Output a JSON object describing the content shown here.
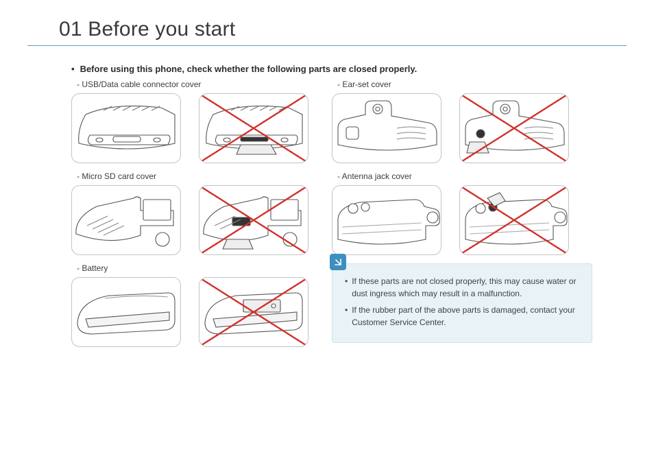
{
  "title": "01 Before you start",
  "intro": "Before using this phone, check whether the following parts are closed properly.",
  "left": {
    "labels": {
      "usb": "- USB/Data cable connector cover",
      "sd": "- Micro SD card cover",
      "bat": "- Battery"
    }
  },
  "right": {
    "labels": {
      "ear": "- Ear-set cover",
      "ant": "- Antenna jack cover"
    }
  },
  "note": {
    "l1": "If these parts are not closed properly, this may cause water or dust ingress which may result in a malfunction.",
    "l2": "If the rubber part of the above parts is damaged, contact your Customer Service Center."
  }
}
